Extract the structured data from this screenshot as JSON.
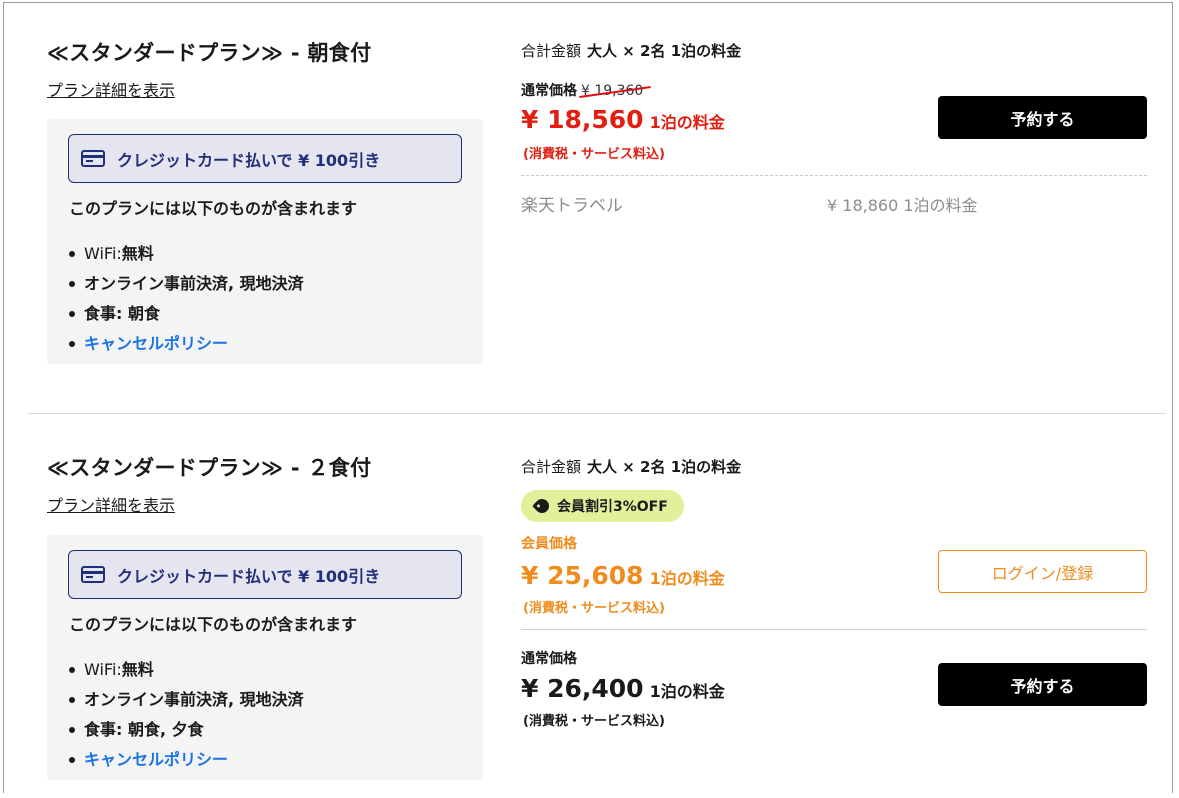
{
  "plans": [
    {
      "title": "≪スタンダードプラン≫ - 朝食付",
      "detail_link": "プラン詳細を表示",
      "credit_badge": "クレジットカード払いで ¥ 100引き",
      "includes_heading": "このプランには以下のものが含まれます",
      "includes": [
        {
          "label": "WiFi: ",
          "value": "無料"
        },
        {
          "label": "",
          "value": "オンライン事前決済, 現地決済"
        },
        {
          "label": "",
          "value": "食事: 朝食"
        },
        {
          "label": "",
          "value": "キャンセルポリシー"
        }
      ],
      "total_label": "合計金額",
      "total_detail": "大人 × 2名 1泊の料金",
      "regular_label": "通常価格",
      "regular_strike": "¥ 19,360",
      "price": "¥ 18,560",
      "price_unit": "1泊の料金",
      "tax_note": "(消費税・サービス料込)",
      "book_button": "予約する",
      "ota_name": "楽天トラベル",
      "ota_price": "¥ 18,860 1泊の料金"
    },
    {
      "title": "≪スタンダードプラン≫ - ２食付",
      "detail_link": "プラン詳細を表示",
      "credit_badge": "クレジットカード払いで ¥ 100引き",
      "includes_heading": "このプランには以下のものが含まれます",
      "includes": [
        {
          "label": "WiFi: ",
          "value": "無料"
        },
        {
          "label": "",
          "value": "オンライン事前決済, 現地決済"
        },
        {
          "label": "",
          "value": "食事: 朝食, 夕食"
        },
        {
          "label": "",
          "value": "キャンセルポリシー"
        }
      ],
      "total_label": "合計金額",
      "total_detail": "大人 × 2名 1泊の料金",
      "member_badge": "会員割引3%OFF",
      "member_label": "会員価格",
      "member_price": "¥ 25,608",
      "member_unit": "1泊の料金",
      "member_tax": "(消費税・サービス料込)",
      "login_button": "ログイン/登録",
      "regular_label": "通常価格",
      "regular_price": "¥ 26,400",
      "regular_unit": "1泊の料金",
      "regular_tax": "(消費税・サービス料込)",
      "book_button": "予約する"
    }
  ],
  "colors": {
    "price_red": "#e21e10",
    "member_orange": "#f08c1e",
    "credit_navy": "#1f2f7a",
    "link_blue": "#1a73e8",
    "member_badge_bg": "#e3ef9b"
  }
}
